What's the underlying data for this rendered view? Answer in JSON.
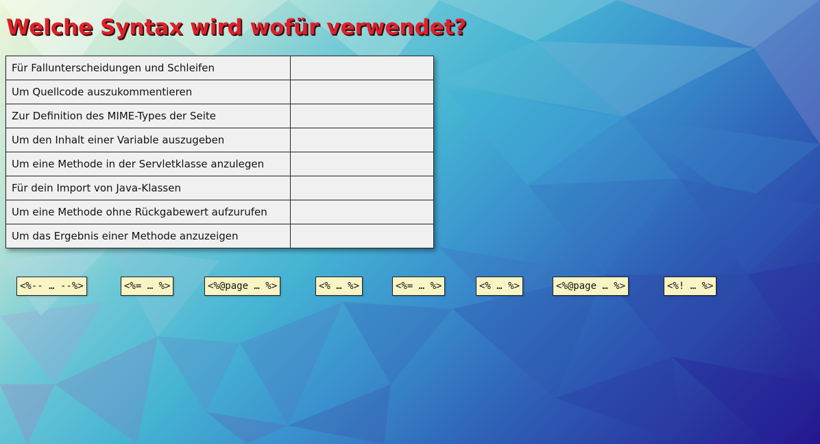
{
  "title": "Welche Syntax wird wofür verwendet?",
  "rows": [
    {
      "question": "Für Fallunterscheidungen und Schleifen",
      "answer": ""
    },
    {
      "question": "Um Quellcode auszukommentieren",
      "answer": ""
    },
    {
      "question": "Zur Definition des MIME-Types der Seite",
      "answer": ""
    },
    {
      "question": "Um den Inhalt einer Variable auszugeben",
      "answer": ""
    },
    {
      "question": "Um eine Methode in der Servletklasse anzulegen",
      "answer": ""
    },
    {
      "question": "Für dein Import von Java-Klassen",
      "answer": ""
    },
    {
      "question": "Um eine Methode ohne Rückgabewert aufzurufen",
      "answer": ""
    },
    {
      "question": "Um das Ergebnis einer Methode anzuzeigen",
      "answer": ""
    }
  ],
  "tokens": [
    "<%-- … --%>",
    "<%= … %>",
    "<%@page … %>",
    "<% … %>",
    "<%= … %>",
    "<% … %>",
    "<%@page … %>",
    "<%! … %>"
  ],
  "colors": {
    "title": "#e0202a",
    "table_bg": "#f0f0f0",
    "token_bg": "#f8f4c4"
  }
}
